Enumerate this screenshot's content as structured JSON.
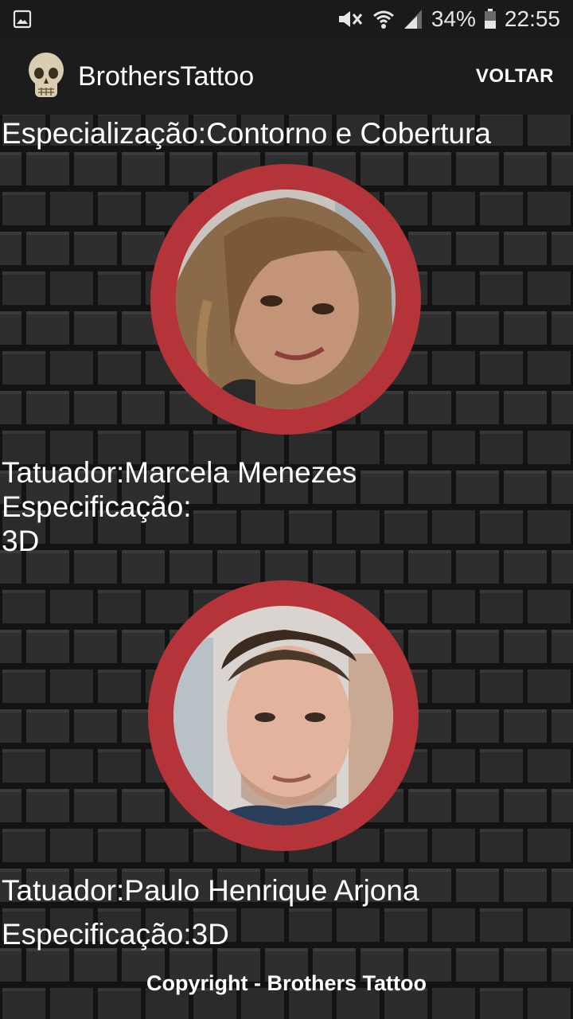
{
  "status_bar": {
    "battery": "34%",
    "time": "22:55",
    "icons": [
      "image-icon",
      "mute-icon",
      "wifi-icon",
      "signal-icon",
      "battery-icon"
    ]
  },
  "app_bar": {
    "title": "BrothersTattoo",
    "action_label": "VOLTAR",
    "logo_icon": "skull-icon"
  },
  "content": {
    "specializacao": "Especialização:Contorno e Cobertura",
    "tattooists": [
      {
        "name": "Tatuador:Marcela Menezes",
        "spec_label": "Especificação:",
        "spec_value": "3D",
        "photo_icon": "person-photo"
      },
      {
        "name": "Tatuador:Paulo Henrique Arjona",
        "spec_label": "Especificação:3D",
        "photo_icon": "person-photo"
      }
    ],
    "copyright": "Copyright - Brothers Tattoo"
  },
  "colors": {
    "avatar_ring": "#b5343a",
    "wall_brick": "#2b2b2b",
    "wall_mortar": "#121212",
    "app_bar": "#1c1c1c"
  }
}
